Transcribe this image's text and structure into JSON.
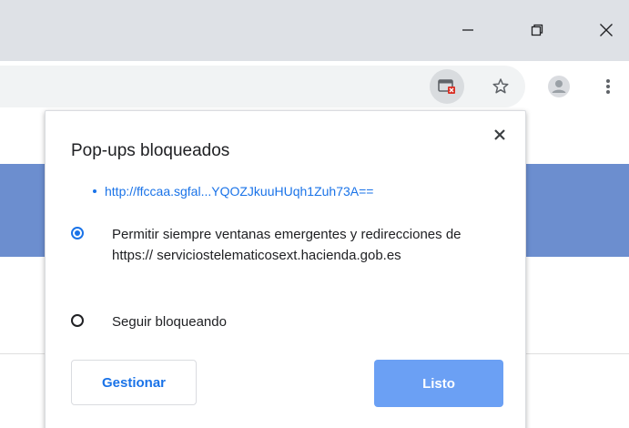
{
  "window": {
    "minimize_icon": "minimize-icon",
    "restore_icon": "restore-icon",
    "close_icon": "close-icon"
  },
  "toolbar": {
    "icons": [
      "popup-blocked-icon",
      "star-icon",
      "avatar",
      "menu-icon"
    ]
  },
  "bubble": {
    "title": "Pop-ups bloqueados",
    "blocked_popups": [
      "http://ffccaa.sgfal...YQOZJkuuHUqh1Zuh73A=="
    ],
    "options": [
      {
        "label": "Permitir siempre ventanas emergentes y redirecciones de https:// serviciostelematicosext.hacienda.gob.es",
        "selected": true
      },
      {
        "label": "Seguir bloqueando",
        "selected": false
      }
    ],
    "manage_label": "Gestionar",
    "done_label": "Listo"
  },
  "colors": {
    "accent": "#1a73e8",
    "done_button": "#6ba0f4",
    "page_band": "#6c8ecf",
    "titlebar": "#dee1e6"
  }
}
